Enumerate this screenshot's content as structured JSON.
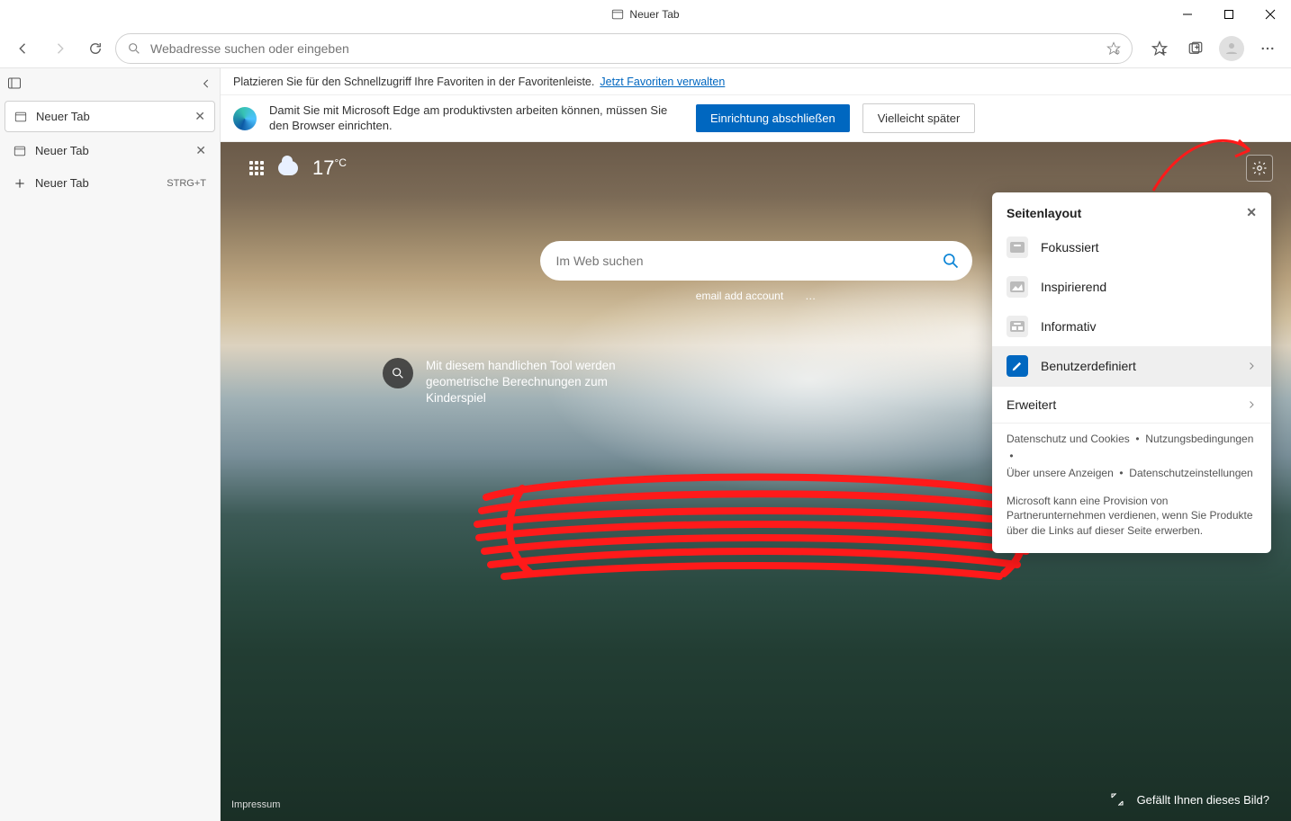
{
  "window": {
    "title": "Neuer Tab"
  },
  "urlbar": {
    "placeholder": "Webadresse suchen oder eingeben"
  },
  "vtabs": {
    "tabs": [
      {
        "label": "Neuer Tab"
      },
      {
        "label": "Neuer Tab"
      }
    ],
    "new_tab_label": "Neuer Tab",
    "new_tab_shortcut": "STRG+T"
  },
  "favbar": {
    "text": "Platzieren Sie für den Schnellzugriff Ihre Favoriten in der Favoritenleiste.",
    "link": "Jetzt Favoriten verwalten"
  },
  "setup": {
    "text": "Damit Sie mit Microsoft Edge am produktivsten arbeiten können, müssen Sie den Browser einrichten.",
    "primary": "Einrichtung abschließen",
    "secondary": "Vielleicht später"
  },
  "hero": {
    "temperature_value": "17",
    "temperature_unit": "°C",
    "search_placeholder": "Im Web suchen",
    "quicklinks": [
      "email add account",
      "…"
    ],
    "promo_text": "Mit diesem handlichen Tool werden geometrische Berechnungen zum Kinderspiel",
    "impressum": "Impressum",
    "like_label": "Gefällt Ihnen dieses Bild?"
  },
  "popover": {
    "title": "Seitenlayout",
    "items": [
      {
        "label": "Fokussiert"
      },
      {
        "label": "Inspirierend"
      },
      {
        "label": "Informativ"
      },
      {
        "label": "Benutzerdefiniert"
      }
    ],
    "expand": "Erweitert",
    "footer_links": [
      "Datenschutz und Cookies",
      "Nutzungsbedingungen",
      "Über unsere Anzeigen",
      "Datenschutzeinstellungen"
    ],
    "note": "Microsoft kann eine Provision von Partnerunternehmen verdienen, wenn Sie Produkte über die Links auf dieser Seite erwerben."
  }
}
